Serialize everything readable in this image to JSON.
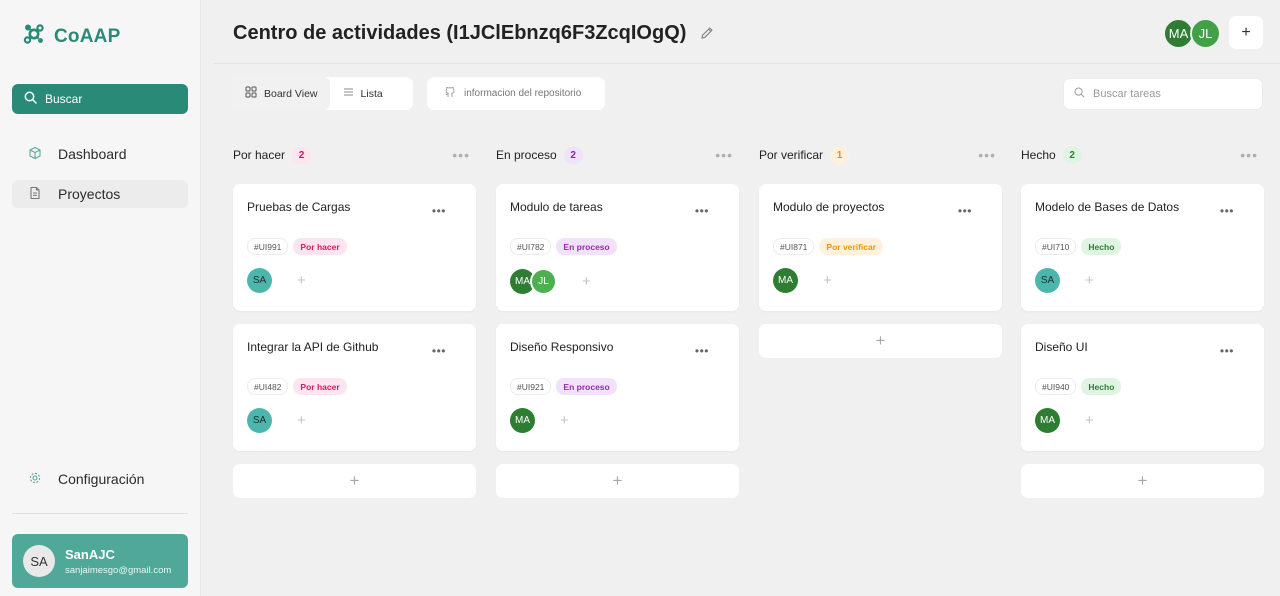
{
  "app": {
    "name": "CoAAP",
    "colors": {
      "accent": "#2a8a78",
      "user_card": "#4fa898"
    }
  },
  "sidebar": {
    "search_label": "Buscar",
    "items": [
      {
        "label": "Dashboard",
        "icon": "cube-icon"
      },
      {
        "label": "Proyectos",
        "icon": "document-icon"
      }
    ],
    "settings_label": "Configuración",
    "user": {
      "initials": "SA",
      "name": "SanAJC",
      "email": "sanjaimesgo@gmail.com"
    }
  },
  "header": {
    "title": "Centro de actividades (I1JClEbnzq6F3ZcqIOgQ)",
    "members": [
      "MA",
      "JL"
    ],
    "add_member_label": "+"
  },
  "toolbar": {
    "board_view_label": "Board View",
    "list_label": "Lista",
    "repo_label": "informacion del repositorio",
    "search_placeholder": "Buscar tareas"
  },
  "columns": [
    {
      "title": "Por hacer",
      "count": "2",
      "badge_colors": {
        "bg": "#fde4ef",
        "fg": "#c2185b"
      },
      "cards": [
        {
          "title": "Pruebas de Cargas",
          "id": "#UI991",
          "status": "Por hacer",
          "assignees": [
            "SA"
          ]
        },
        {
          "title": "Integrar la API de Github",
          "id": "#UI482",
          "status": "Por hacer",
          "assignees": [
            "SA"
          ]
        }
      ]
    },
    {
      "title": "En proceso",
      "count": "2",
      "badge_colors": {
        "bg": "#f1e2fb",
        "fg": "#8e24aa"
      },
      "cards": [
        {
          "title": "Modulo de tareas",
          "id": "#UI782",
          "status": "En proceso",
          "assignees": [
            "MA",
            "JL"
          ]
        },
        {
          "title": "Diseño Responsivo",
          "id": "#UI921",
          "status": "En proceso",
          "assignees": [
            "MA"
          ]
        }
      ]
    },
    {
      "title": "Por verificar",
      "count": "1",
      "badge_colors": {
        "bg": "#fff1dc",
        "fg": "#ef8f00"
      },
      "cards": [
        {
          "title": "Modulo de proyectos",
          "id": "#UI871",
          "status": "Por verificar",
          "assignees": [
            "MA"
          ]
        }
      ]
    },
    {
      "title": "Hecho",
      "count": "2",
      "badge_colors": {
        "bg": "#e0f4e4",
        "fg": "#2e7d32"
      },
      "cards": [
        {
          "title": "Modelo de Bases de Datos",
          "id": "#UI710",
          "status": "Hecho",
          "assignees": [
            "SA"
          ]
        },
        {
          "title": "Diseño UI",
          "id": "#UI940",
          "status": "Hecho",
          "assignees": [
            "MA"
          ]
        }
      ]
    }
  ],
  "add_card_label": "+"
}
